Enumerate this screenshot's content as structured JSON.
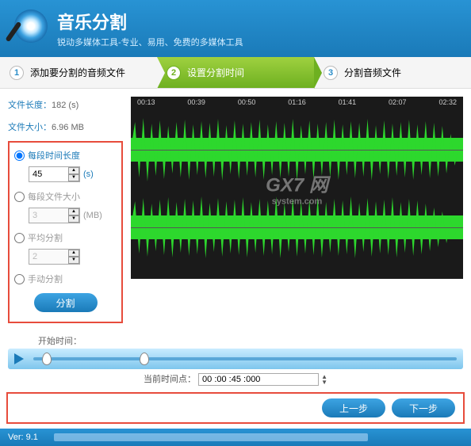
{
  "header": {
    "title": "音乐分割",
    "subtitle": "锐动多媒体工具-专业、易用、免费的多媒体工具"
  },
  "steps": {
    "s1": {
      "num": "1",
      "label": "添加要分割的音频文件"
    },
    "s2": {
      "num": "2",
      "label": "设置分割时间"
    },
    "s3": {
      "num": "3",
      "label": "分割音频文件"
    }
  },
  "file_info": {
    "length_label": "文件长度：",
    "length_value": "182 (s)",
    "size_label": "文件大小：",
    "size_value": "6.96 MB"
  },
  "options": {
    "by_duration": {
      "label": "每段时间长度",
      "value": "45",
      "unit": "(s)"
    },
    "by_size": {
      "label": "每段文件大小",
      "value": "3",
      "unit": "(MB)"
    },
    "average": {
      "label": "平均分割",
      "value": "2"
    },
    "manual": {
      "label": "手动分割"
    },
    "split_btn": "分割"
  },
  "timeline": [
    "00:13",
    "00:39",
    "00:50",
    "01:16",
    "01:41",
    "02:07",
    "02:32"
  ],
  "watermark": {
    "main": "GX7 网",
    "sub": "system.com"
  },
  "player": {
    "start_label": "开始时间：",
    "current_label": "当前时间点：",
    "current_value": "00 :00 :45 :000"
  },
  "footer": {
    "prev": "上一步",
    "next": "下一步"
  },
  "version": {
    "label": "Ver: 9.1"
  }
}
